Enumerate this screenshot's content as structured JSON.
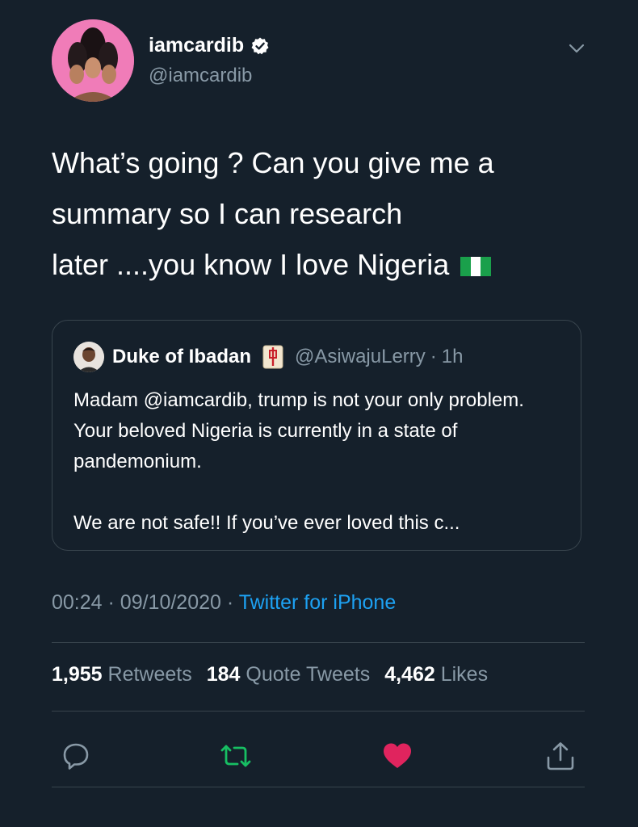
{
  "author": {
    "display_name": "iamcardib",
    "handle": "@iamcardib",
    "verified": true
  },
  "tweet_text": "What’s going ? Can you give me a\nsummary so I can research\nlater ....you know I love Nigeria",
  "tweet_flag_icon": "nigeria-flag-icon",
  "quoted_tweet": {
    "display_name": "Duke of Ibadan",
    "name_emoji_icon": "mahjong-red-dragon-icon",
    "handle": "@AsiwajuLerry",
    "separator": "·",
    "time": "1h",
    "paragraph_1": "Madam @iamcardib, trump is not your only problem. Your beloved Nigeria is currently in a state of pandemonium.",
    "paragraph_2": "We are not safe!! If you’ve ever loved this c..."
  },
  "meta": {
    "time": "00:24",
    "separator": "·",
    "date": "09/10/2020",
    "source": "Twitter for iPhone"
  },
  "stats": {
    "retweets_count": "1,955",
    "retweets_label": "Retweets",
    "quote_tweets_count": "184",
    "quote_tweets_label": "Quote Tweets",
    "likes_count": "4,462",
    "likes_label": "Likes"
  },
  "actions": [
    "reply-icon",
    "retweet-icon",
    "like-icon",
    "share-icon"
  ],
  "colors": {
    "background": "#15202b",
    "text_primary": "#ffffff",
    "text_secondary": "#8899a6",
    "link": "#1da1f2",
    "divider": "#38444d",
    "retweet_active": "#17bf63",
    "like_active": "#e0245e",
    "avatar_background": "#f07cb8"
  }
}
